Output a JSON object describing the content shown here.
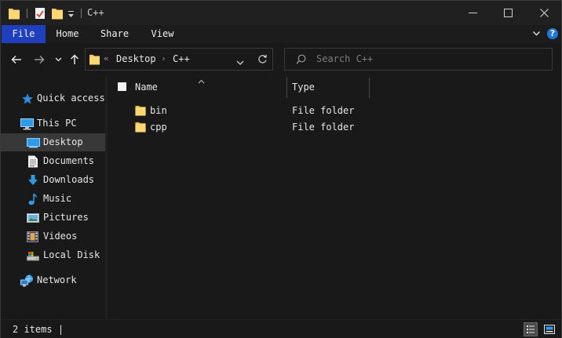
{
  "window": {
    "title": "C++",
    "controls": [
      "minimize",
      "maximize",
      "close"
    ]
  },
  "quick_access_toolbar": {
    "icons": [
      "folder-icon",
      "properties-icon",
      "new-folder-icon",
      "customize-dropdown-icon"
    ]
  },
  "ribbon": {
    "tabs": [
      {
        "label": "File",
        "active": true
      },
      {
        "label": "Home",
        "active": false
      },
      {
        "label": "Share",
        "active": false
      },
      {
        "label": "View",
        "active": false
      }
    ],
    "help": "?"
  },
  "navigation": {
    "breadcrumb": {
      "overflow": "«",
      "items": [
        "Desktop",
        "C++"
      ],
      "separator": "›"
    },
    "search_placeholder": "Search C++"
  },
  "sidebar": {
    "items": [
      {
        "label": "Quick access",
        "icon": "star-icon",
        "level": 0,
        "selected": false
      },
      {
        "label": "This PC",
        "icon": "computer-icon",
        "level": 0,
        "selected": false
      },
      {
        "label": "Desktop",
        "icon": "desktop-icon",
        "level": 1,
        "selected": true
      },
      {
        "label": "Documents",
        "icon": "documents-icon",
        "level": 1,
        "selected": false
      },
      {
        "label": "Downloads",
        "icon": "download-icon",
        "level": 1,
        "selected": false
      },
      {
        "label": "Music",
        "icon": "music-icon",
        "level": 1,
        "selected": false
      },
      {
        "label": "Pictures",
        "icon": "pictures-icon",
        "level": 1,
        "selected": false
      },
      {
        "label": "Videos",
        "icon": "videos-icon",
        "level": 1,
        "selected": false
      },
      {
        "label": "Local Disk",
        "icon": "drive-icon",
        "level": 1,
        "selected": false
      },
      {
        "label": "Network",
        "icon": "network-icon",
        "level": 0,
        "selected": false
      }
    ]
  },
  "file_list": {
    "columns": [
      "Name",
      "Type"
    ],
    "rows": [
      {
        "name": "bin",
        "type": "File folder"
      },
      {
        "name": "cpp",
        "type": "File folder"
      }
    ]
  },
  "status": {
    "item_count": "2 items",
    "cursor": "|"
  },
  "colors": {
    "file_tab": "#1f3fbf",
    "folder_yellow": "#f4c95d",
    "selection": "#383838",
    "accent_blue": "#1e78d7"
  }
}
